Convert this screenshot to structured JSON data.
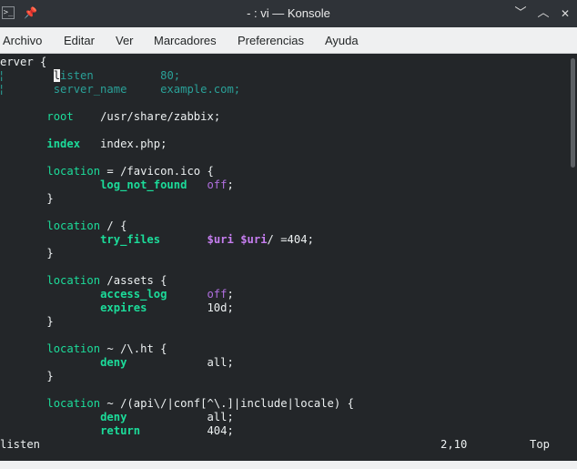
{
  "window": {
    "title": "- : vi — Konsole",
    "app_icon": "terminal-icon",
    "pin_icon": "pin-icon",
    "controls": {
      "minimize": "﹀",
      "maximize": "︿",
      "close": "✕"
    }
  },
  "menu": {
    "items": [
      "Archivo",
      "Editar",
      "Ver",
      "Marcadores",
      "Preferencias",
      "Ayuda"
    ]
  },
  "editor": {
    "lines": [
      [
        {
          "t": "erver {",
          "c": "plain"
        }
      ],
      [
        {
          "t": "        ",
          "c": "plain"
        },
        {
          "t": "l",
          "c": "cursor"
        },
        {
          "t": "isten          80;",
          "c": "dim"
        }
      ],
      [
        {
          "t": "        server_name     example.com;",
          "c": "dim"
        }
      ],
      [
        {
          "t": "",
          "c": "plain"
        }
      ],
      [
        {
          "t": "       ",
          "c": "plain"
        },
        {
          "t": "root",
          "c": "kwn"
        },
        {
          "t": "    /usr/share/zabbix;",
          "c": "plain"
        }
      ],
      [
        {
          "t": "",
          "c": "plain"
        }
      ],
      [
        {
          "t": "       ",
          "c": "plain"
        },
        {
          "t": "index",
          "c": "kw"
        },
        {
          "t": "   index.php;",
          "c": "plain"
        }
      ],
      [
        {
          "t": "",
          "c": "plain"
        }
      ],
      [
        {
          "t": "       ",
          "c": "plain"
        },
        {
          "t": "location",
          "c": "kwn"
        },
        {
          "t": " = /favicon.ico {",
          "c": "plain"
        }
      ],
      [
        {
          "t": "               ",
          "c": "plain"
        },
        {
          "t": "log_not_found",
          "c": "kw"
        },
        {
          "t": "   ",
          "c": "plain"
        },
        {
          "t": "off",
          "c": "off"
        },
        {
          "t": ";",
          "c": "plain"
        }
      ],
      [
        {
          "t": "       }",
          "c": "plain"
        }
      ],
      [
        {
          "t": "",
          "c": "plain"
        }
      ],
      [
        {
          "t": "       ",
          "c": "plain"
        },
        {
          "t": "location",
          "c": "kwn"
        },
        {
          "t": " / {",
          "c": "plain"
        }
      ],
      [
        {
          "t": "               ",
          "c": "plain"
        },
        {
          "t": "try_files",
          "c": "kw"
        },
        {
          "t": "       ",
          "c": "plain"
        },
        {
          "t": "$uri",
          "c": "var"
        },
        {
          "t": " ",
          "c": "plain"
        },
        {
          "t": "$uri",
          "c": "var"
        },
        {
          "t": "/ =404;",
          "c": "plain"
        }
      ],
      [
        {
          "t": "       }",
          "c": "plain"
        }
      ],
      [
        {
          "t": "",
          "c": "plain"
        }
      ],
      [
        {
          "t": "       ",
          "c": "plain"
        },
        {
          "t": "location",
          "c": "kwn"
        },
        {
          "t": " /assets {",
          "c": "plain"
        }
      ],
      [
        {
          "t": "               ",
          "c": "plain"
        },
        {
          "t": "access_log",
          "c": "kw"
        },
        {
          "t": "      ",
          "c": "plain"
        },
        {
          "t": "off",
          "c": "off"
        },
        {
          "t": ";",
          "c": "plain"
        }
      ],
      [
        {
          "t": "               ",
          "c": "plain"
        },
        {
          "t": "expires",
          "c": "kw"
        },
        {
          "t": "         10d;",
          "c": "plain"
        }
      ],
      [
        {
          "t": "       }",
          "c": "plain"
        }
      ],
      [
        {
          "t": "",
          "c": "plain"
        }
      ],
      [
        {
          "t": "       ",
          "c": "plain"
        },
        {
          "t": "location",
          "c": "kwn"
        },
        {
          "t": " ~ /\\.ht {",
          "c": "plain"
        }
      ],
      [
        {
          "t": "               ",
          "c": "plain"
        },
        {
          "t": "deny",
          "c": "kw"
        },
        {
          "t": "            all;",
          "c": "plain"
        }
      ],
      [
        {
          "t": "       }",
          "c": "plain"
        }
      ],
      [
        {
          "t": "",
          "c": "plain"
        }
      ],
      [
        {
          "t": "       ",
          "c": "plain"
        },
        {
          "t": "location",
          "c": "kwn"
        },
        {
          "t": " ~ /(api\\/|conf[^\\.]|include|locale) {",
          "c": "plain"
        }
      ],
      [
        {
          "t": "               ",
          "c": "plain"
        },
        {
          "t": "deny",
          "c": "kw"
        },
        {
          "t": "            all;",
          "c": "plain"
        }
      ],
      [
        {
          "t": "               ",
          "c": "plain"
        },
        {
          "t": "return",
          "c": "kw"
        },
        {
          "t": "          404;",
          "c": "plain"
        }
      ]
    ],
    "gutter_marks": [
      "¦",
      "¦"
    ]
  },
  "status": {
    "message": "listen",
    "position": "2,10",
    "scroll": "Top"
  }
}
